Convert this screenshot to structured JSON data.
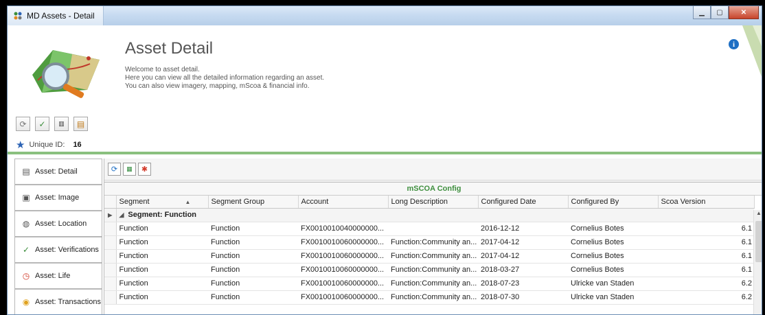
{
  "window": {
    "title": "MD Assets - Detail"
  },
  "header": {
    "title": "Asset Detail",
    "intro": [
      "Welcome to asset detail.",
      "Here you can view all the detailed information regarding an asset.",
      "You can also view imagery, mapping, mScoa & financial info."
    ],
    "unique_label": "Unique ID:",
    "unique_value": "16"
  },
  "nav": {
    "items": [
      {
        "label": "Asset: Detail",
        "icon": "detail-card-icon"
      },
      {
        "label": "Asset: Image",
        "icon": "image-icon"
      },
      {
        "label": "Asset: Location",
        "icon": "globe-location-icon"
      },
      {
        "label": "Asset: Verifications",
        "icon": "checkmark-icon"
      },
      {
        "label": "Asset: Life",
        "icon": "clock-icon"
      },
      {
        "label": "Asset: Transactions",
        "icon": "coins-icon"
      }
    ]
  },
  "grid": {
    "caption": "mSCOA Config",
    "columns": [
      "Segment",
      "Segment Group",
      "Account",
      "Long Description",
      "Configured Date",
      "Configured By",
      "Scoa Version"
    ],
    "group_label": "Segment: Function",
    "rows": [
      [
        "Function",
        "Function",
        "FX0010010040000000...",
        "",
        "2016-12-12",
        "Cornelius Botes",
        "6.1"
      ],
      [
        "Function",
        "Function",
        "FX0010010060000000...",
        "Function:Community an...",
        "2017-04-12",
        "Cornelius Botes",
        "6.1"
      ],
      [
        "Function",
        "Function",
        "FX0010010060000000...",
        "Function:Community an...",
        "2017-04-12",
        "Cornelius Botes",
        "6.1"
      ],
      [
        "Function",
        "Function",
        "FX0010010060000000...",
        "Function:Community an...",
        "2018-03-27",
        "Cornelius Botes",
        "6.1"
      ],
      [
        "Function",
        "Function",
        "FX0010010060000000...",
        "Function:Community an...",
        "2018-07-23",
        "Ulricke van Staden",
        "6.2"
      ],
      [
        "Function",
        "Function",
        "FX0010010060000000...",
        "Function:Community an...",
        "2018-07-30",
        "Ulricke van Staden",
        "6.2"
      ]
    ]
  },
  "colors": {
    "accent_green": "#8ac07e",
    "caption_green": "#3f8f3f",
    "info_blue": "#1e6fc4"
  }
}
